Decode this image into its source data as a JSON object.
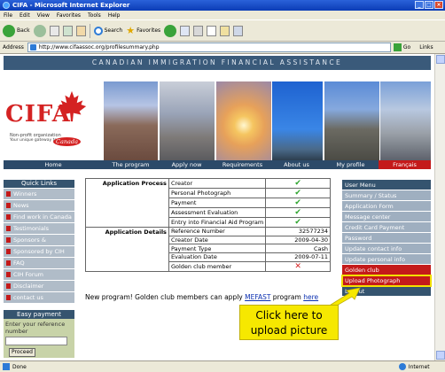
{
  "window": {
    "title": "CIFA - Microsoft Internet Explorer"
  },
  "menubar": [
    "File",
    "Edit",
    "View",
    "Favorites",
    "Tools",
    "Help"
  ],
  "toolbar": {
    "back": "Back",
    "search": "Search",
    "favorites": "Favorites"
  },
  "address": {
    "label": "Address",
    "url": "http://www.cifaassoc.org/profilesummary.php",
    "go": "Go",
    "links": "Links"
  },
  "banner": "CANADIAN IMMIGRATION FINANCIAL ASSISTANCE",
  "logo": {
    "text": "CIFA",
    "sub1": "Non-profit organization",
    "sub2": "Your unique gateway to",
    "canada": "Canada"
  },
  "nav": [
    {
      "label": "Home"
    },
    {
      "label": "The program"
    },
    {
      "label": "Apply now"
    },
    {
      "label": "Requirements"
    },
    {
      "label": "About us"
    },
    {
      "label": "My profile"
    },
    {
      "label": "Français"
    }
  ],
  "quick_links": {
    "title": "Quick Links",
    "items": [
      "Winners",
      "News",
      "Find work in Canada",
      "Testimonials",
      "Sponsors & Witnesses",
      "Sponsored by CIH",
      "FAQ",
      "CIH Forum",
      "Disclaimer",
      "contact us"
    ]
  },
  "easy_payment": {
    "title": "Easy payment",
    "label": "Enter your reference number",
    "button": "Proceed"
  },
  "application": {
    "process_label": "Application Process",
    "process_rows": [
      {
        "name": "Creator",
        "mark": "check"
      },
      {
        "name": "Personal Photograph",
        "mark": "check"
      },
      {
        "name": "Payment",
        "mark": "check"
      },
      {
        "name": "Assessment Evaluation",
        "mark": "check"
      },
      {
        "name": "Entry into Financial Aid Program",
        "mark": "check"
      }
    ],
    "details_label": "Application Details",
    "details_rows": [
      {
        "name": "Reference Number",
        "value": "32577234"
      },
      {
        "name": "Creator Date",
        "value": "2009-04-30"
      },
      {
        "name": "Payment Type",
        "value": "Cash"
      },
      {
        "name": "Evaluation Date",
        "value": "2009-07-11"
      },
      {
        "name": "Golden club member",
        "mark": "cross"
      }
    ]
  },
  "promo": {
    "text": "New program! Golden club members can apply ",
    "link": "MEFAST",
    "text2": " program ",
    "here": "here"
  },
  "user_menu": [
    {
      "label": "User Menu",
      "style": "head"
    },
    {
      "label": "Summary / Status",
      "style": ""
    },
    {
      "label": "Application Form",
      "style": ""
    },
    {
      "label": "Message center",
      "style": ""
    },
    {
      "label": "Credit Card Payment",
      "style": ""
    },
    {
      "label": "Password",
      "style": ""
    },
    {
      "label": "Update contact info",
      "style": ""
    },
    {
      "label": "Update personal info",
      "style": ""
    },
    {
      "label": "Golden club",
      "style": "red"
    },
    {
      "label": "Upload Photograph",
      "style": "hl"
    },
    {
      "label": "Logout",
      "style": "dark"
    }
  ],
  "tip": {
    "line1": "Click here to",
    "line2": "upload picture"
  },
  "status": {
    "left": "Done",
    "right": "Internet"
  },
  "colors": {
    "titlebar": "#0b3cb6",
    "banner": "#3a5a7a",
    "accent_red": "#c41a1a",
    "highlight": "#f6e800"
  }
}
